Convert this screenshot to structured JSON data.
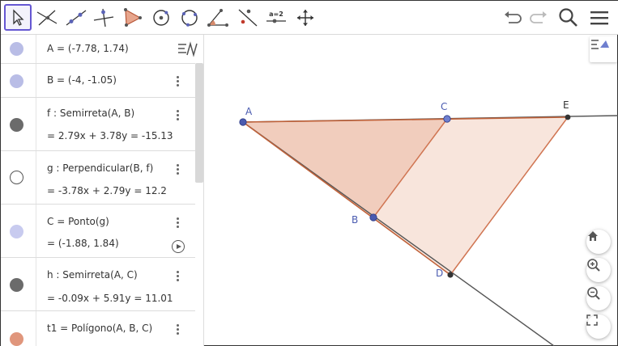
{
  "toolbar": {
    "tools": [
      {
        "name": "move",
        "active": true
      },
      {
        "name": "segment-through-point"
      },
      {
        "name": "line"
      },
      {
        "name": "perpendicular-line"
      },
      {
        "name": "polygon"
      },
      {
        "name": "circle-center-point"
      },
      {
        "name": "circle-three-points"
      },
      {
        "name": "angle"
      },
      {
        "name": "reflect-about-line"
      },
      {
        "name": "slider",
        "label": "a=2"
      },
      {
        "name": "move-graphics-view"
      }
    ],
    "undo_icon": "undo-icon",
    "redo_icon": "redo-icon",
    "search_icon": "search-icon",
    "menu_icon": "menu-icon"
  },
  "algebra": {
    "rows": [
      {
        "definition": "A = (-7.78, 1.74)",
        "color": "#b9bde6"
      },
      {
        "definition": "B = (-4, -1.05)",
        "color": "#b9bde6"
      },
      {
        "definition": "f : Semirreta(A, B)",
        "output": "= 2.79x + 3.78y = -15.13",
        "color": "#6b6b6b"
      },
      {
        "definition": "g : Perpendicular(B, f)",
        "output": "= -3.78x + 2.79y = 12.2",
        "color": "#ffffff"
      },
      {
        "definition": "C = Ponto(g)",
        "output": "= (-1.88, 1.84)",
        "color": "#c8cbef"
      },
      {
        "definition": "h : Semirreta(A, C)",
        "output": "= -0.09x + 5.91y = 11.01",
        "color": "#6b6b6b"
      },
      {
        "definition": "t1 = Polígono(A, B, C)",
        "color": "#e0967c"
      }
    ]
  },
  "graphics": {
    "points": {
      "A": "A",
      "B": "B",
      "C": "C",
      "D": "D",
      "E": "E"
    },
    "colors": {
      "polygon_fill": "#f3d2c4",
      "polygon_edge": "#c0623a",
      "point": "#4a5bb0",
      "line": "#555555"
    },
    "nav": [
      "home-icon",
      "zoom-in-icon",
      "zoom-out-icon",
      "fullscreen-icon"
    ]
  }
}
